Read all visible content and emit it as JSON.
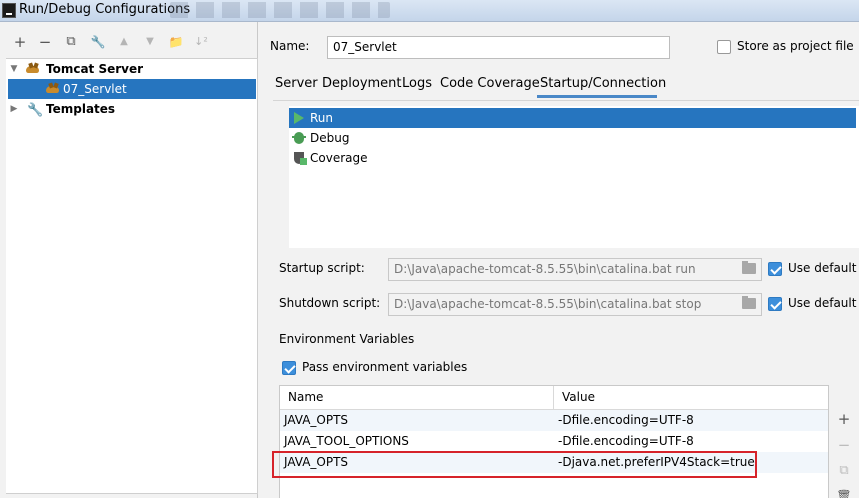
{
  "window": {
    "title": "Run/Debug Configurations"
  },
  "left_toolbar": {
    "add": "+",
    "remove": "−",
    "copy": "⧉",
    "wrench": "🔧",
    "up": "▲",
    "down": "▼",
    "folder": "📁",
    "sort": "↓²"
  },
  "tree": {
    "group": "Tomcat Server",
    "item": "07_Servlet",
    "templates": "Templates",
    "expanded_marker": "▼",
    "collapsed_marker": "▶"
  },
  "config": {
    "name_label": "Name:",
    "name_value": "07_Servlet",
    "store_label": "Store as project file"
  },
  "tabs": [
    "Server",
    "Deployment",
    "Logs",
    "Code Coverage",
    "Startup/Connection"
  ],
  "active_tab": "Startup/Connection",
  "modes": [
    "Run",
    "Debug",
    "Coverage"
  ],
  "startup": {
    "label": "Startup script:",
    "value": "D:\\Java\\apache-tomcat-8.5.55\\bin\\catalina.bat run",
    "use_default": "Use default"
  },
  "shutdown": {
    "label": "Shutdown script:",
    "value": "D:\\Java\\apache-tomcat-8.5.55\\bin\\catalina.bat stop",
    "use_default": "Use default"
  },
  "env": {
    "section_label": "Environment Variables",
    "pass_label": "Pass environment variables",
    "columns": [
      "Name",
      "Value"
    ],
    "rows": [
      {
        "name": "JAVA_OPTS",
        "value": "-Dfile.encoding=UTF-8"
      },
      {
        "name": "JAVA_TOOL_OPTIONS",
        "value": "-Dfile.encoding=UTF-8"
      },
      {
        "name": "JAVA_OPTS",
        "value": "-Djava.net.preferIPV4Stack=true"
      }
    ]
  },
  "table_tools": {
    "add": "+",
    "remove": "−",
    "copy": "⧉",
    "delete": "🗑"
  },
  "colors": {
    "selection": "#2675bf",
    "highlight_box": "#d6232a",
    "run_green": "#59b86a"
  }
}
